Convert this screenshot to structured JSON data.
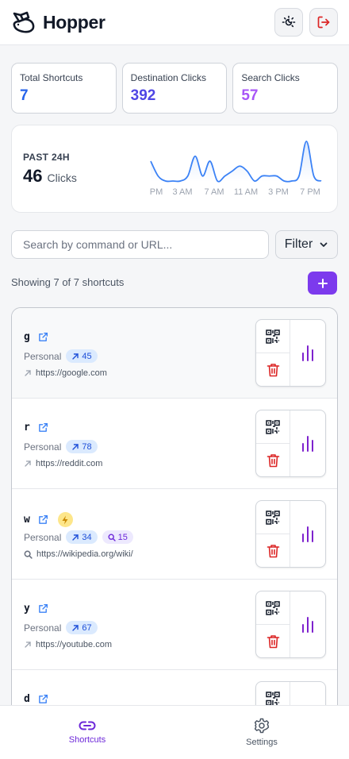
{
  "app": {
    "title": "Hopper"
  },
  "header": {
    "theme_icon": "theme-toggle-icon",
    "logout_icon": "logout-icon"
  },
  "stats": [
    {
      "label": "Total Shortcuts",
      "value": "7",
      "color": "#2563eb"
    },
    {
      "label": "Destination Clicks",
      "value": "392",
      "color": "#4f46e5"
    },
    {
      "label": "Search Clicks",
      "value": "57",
      "color": "#a855f7"
    }
  ],
  "activity": {
    "period_label": "PAST 24H",
    "count": "46",
    "unit": "Clicks",
    "x_ticks": [
      "PM",
      "3 AM",
      "7 AM",
      "11 AM",
      "3 PM",
      "7 PM"
    ],
    "line_color": "#3b82f6"
  },
  "chart_data": {
    "type": "area",
    "title": "",
    "xlabel": "",
    "ylabel": "",
    "x_ticks": [
      "PM",
      "3 AM",
      "7 AM",
      "11 AM",
      "3 PM",
      "7 PM"
    ],
    "values": [
      4,
      1,
      0,
      0,
      0,
      1,
      5,
      1,
      4,
      0,
      1,
      2,
      3,
      2,
      0,
      1,
      1,
      1,
      0,
      0,
      1,
      8,
      1,
      0
    ],
    "grid": false,
    "legend": "none"
  },
  "search": {
    "placeholder": "Search by command or URL...",
    "value": ""
  },
  "filter": {
    "label": "Filter"
  },
  "list": {
    "summary": "Showing 7 of 7 shortcuts",
    "add_icon": "plus-icon",
    "items": [
      {
        "command": "g",
        "category": "Personal",
        "dest_clicks": "45",
        "url": "https://google.com",
        "type": "redirect"
      },
      {
        "command": "r",
        "category": "Personal",
        "dest_clicks": "78",
        "url": "https://reddit.com",
        "type": "redirect"
      },
      {
        "command": "w",
        "category": "Personal",
        "dest_clicks": "34",
        "search_clicks": "15",
        "url": "https://wikipedia.org/wiki/",
        "type": "search"
      },
      {
        "command": "y",
        "category": "Personal",
        "dest_clicks": "67",
        "url": "https://youtube.com",
        "type": "redirect"
      },
      {
        "command": "d",
        "category": "",
        "dest_clicks": "",
        "url": "",
        "type": "redirect"
      }
    ]
  },
  "tabs": [
    {
      "label": "Shortcuts",
      "icon": "link-icon",
      "active": true
    },
    {
      "label": "Settings",
      "icon": "gear-icon",
      "active": false
    }
  ],
  "colors": {
    "accent": "#7c3aed",
    "blue": "#2563eb",
    "danger": "#dc2626"
  }
}
